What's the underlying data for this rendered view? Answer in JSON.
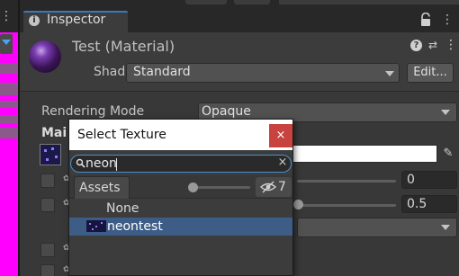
{
  "inspector": {
    "tab_label": "Inspector",
    "tab_icon": "i"
  },
  "material": {
    "title": "Test (Material)",
    "shader_label": "Shader",
    "shader_value": "Standard",
    "edit_button": "Edit...",
    "help_icon": "?",
    "menu_icon": "⋮",
    "preset_icon": "⇄"
  },
  "properties": {
    "rendering_mode_label": "Rendering Mode",
    "rendering_mode_value": "Opaque",
    "main_maps_label": "Mai",
    "metallic_value": "0",
    "smoothness_value": "0.5",
    "eyedropper_icon": "✎"
  },
  "picker": {
    "title": "Select Texture",
    "close_label": "×",
    "search_value": "neon",
    "search_clear": "×",
    "assets_tab": "Assets",
    "hidden_count": "7",
    "items": [
      {
        "label": "None"
      },
      {
        "label": "neontest"
      }
    ]
  },
  "left_panel": {
    "menu_icon": "⋮"
  },
  "colors": {
    "scene_magenta": "#ff00ff",
    "accent_blue": "#3a79bb",
    "selection": "#3d5d87",
    "close_red": "#c8423f"
  },
  "icons": [
    "lock-icon",
    "search-icon",
    "eye-icon",
    "eyedropper-icon",
    "help-icon",
    "gear-icon"
  ]
}
